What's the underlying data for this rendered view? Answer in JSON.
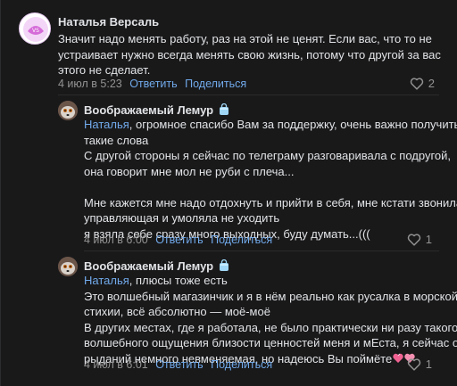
{
  "comments": [
    {
      "author": "Наталья Версаль",
      "lines": [
        "Значит надо менять работу, раз на этой не ценят. Если вас, что то не",
        "устраивает нужно всегда менять свою жизнь, потому что другой за вас",
        "этого не сделает."
      ],
      "date": "4 июл в 5:23",
      "reply_label": "Ответить",
      "share_label": "Поделиться",
      "likes": "2"
    },
    {
      "author": "Воображаемый Лемур",
      "mention": "Наталья",
      "lines": [
        ", огромное спасибо Вам за поддержку, очень важно получить",
        "такие слова",
        "С другой стороны я сейчас по телеграму разговаривала с подругой,",
        "она говорит мне мол не руби с плеча...",
        "",
        "Мне кажется мне надо отдохнуть и прийти в себя, мне кстати звонила",
        "управляющая и умоляла не уходить",
        "я взяла себе сразу много выходных, буду думать...((("
      ],
      "date": "4 июл в 6:00",
      "reply_label": "Ответить",
      "share_label": "Поделиться",
      "likes": "1"
    },
    {
      "author": "Воображаемый Лемур",
      "mention": "Наталья",
      "lines": [
        ", плюсы тоже есть",
        "Это волшебный магазинчик и я в нём реально как русалка в морской",
        "стихии, всё абсолютно — моё-моё",
        "В других местах, где я работала, не было практически ни разу такого",
        "волшебного ощущения близости ценностей меня и мЕста, я сейчас от",
        "рыданий немного невменяемая, но надеюсь Вы поймёте"
      ],
      "date": "4 июл в 6:01",
      "reply_label": "Ответить",
      "share_label": "Поделиться",
      "likes": "1"
    }
  ],
  "icons": {
    "heart": "heart-outline-icon",
    "badge": "bag-badge-icon",
    "emoji": "pink-hearts-emoji"
  },
  "colors": {
    "background": "#19191a",
    "text": "#e1e3e6",
    "link": "#71aaeb",
    "muted": "#939393",
    "badge": "#9fd6f5",
    "emoji": "#f06292"
  }
}
